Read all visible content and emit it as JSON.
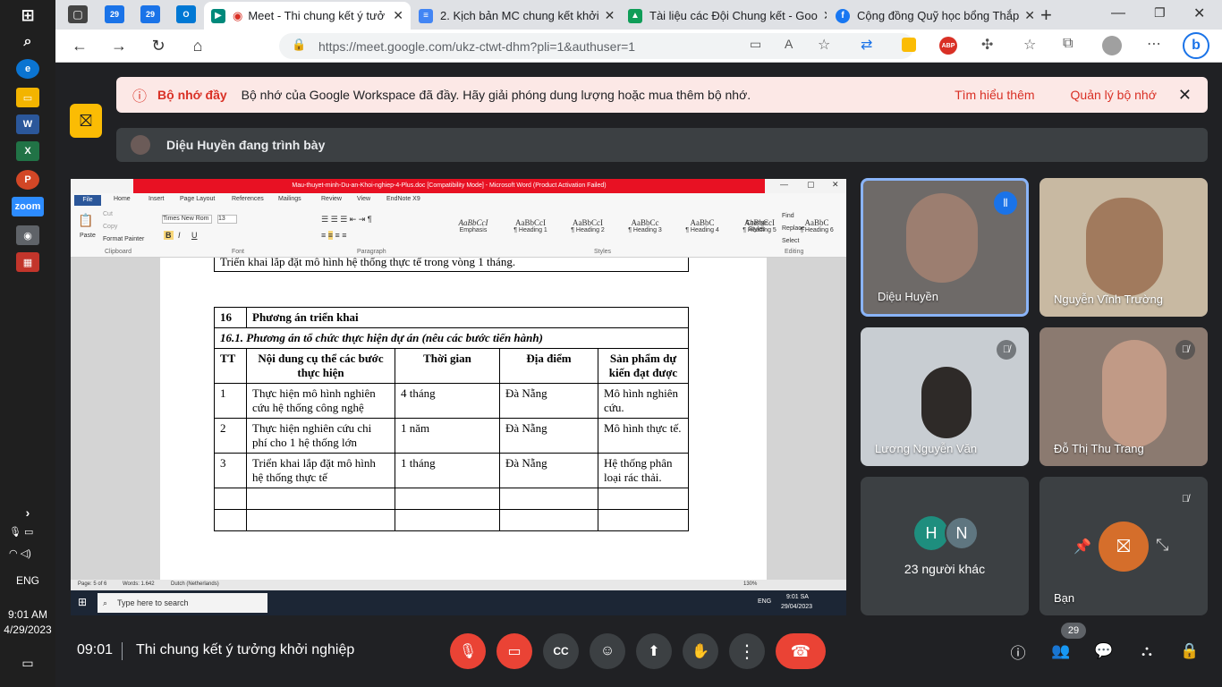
{
  "windows_taskbar": {
    "language": "ENG",
    "time": "9:01 AM",
    "date": "4/29/2023"
  },
  "browser": {
    "tabs": [
      {
        "label": "Meet - Thi chung kết ý tưở",
        "active": true
      },
      {
        "label": "2. Kịch bản MC chung kết khởi"
      },
      {
        "label": "Tài liệu các Đội Chung kết - Goo"
      },
      {
        "label": "Cộng đồng Quỹ học bổng Thắp"
      }
    ],
    "mini_tabs": [
      "29",
      "29"
    ],
    "url": "https://meet.google.com/ukz-ctwt-dhm?pli=1&authuser=1"
  },
  "banner": {
    "title": "Bộ nhớ đầy",
    "message": "Bộ nhớ của Google Workspace đã đầy. Hãy giải phóng dung lượng hoặc mua thêm bộ nhớ.",
    "learn_more": "Tìm hiểu thêm",
    "manage": "Quản lý bộ nhớ"
  },
  "presenting": {
    "label": "Diệu Huyền đang trình bày"
  },
  "word": {
    "title": "Mau-thuyet-minh-Du-an-Khoi-nghiep-4-Plus.doc [Compatibility Mode] - Microsoft Word (Product Activation Failed)",
    "menu": [
      "File",
      "Home",
      "Insert",
      "Page Layout",
      "References",
      "Mailings",
      "Review",
      "View",
      "EndNote X9"
    ],
    "font_name": "Times New Rom",
    "font_size": "13",
    "clipboard": {
      "paste": "Paste",
      "cut": "Cut",
      "copy": "Copy",
      "format_painter": "Format Painter",
      "group": "Clipboard"
    },
    "group_labels": {
      "font": "Font",
      "paragraph": "Paragraph",
      "styles": "Styles",
      "editing": "Editing"
    },
    "styles": [
      {
        "sample": "AaBbCcI",
        "name": "Emphasis"
      },
      {
        "sample": "AaBbCcI",
        "name": "¶ Heading 1"
      },
      {
        "sample": "AaBbCcI",
        "name": "¶ Heading 2"
      },
      {
        "sample": "AaBbCc",
        "name": "¶ Heading 3"
      },
      {
        "sample": "AaBbC",
        "name": "¶ Heading 4"
      },
      {
        "sample": "AaBbCcI",
        "name": "¶ Heading 5"
      },
      {
        "sample": "AaBbC",
        "name": "¶ Heading 6"
      }
    ],
    "change_styles": "Change Styles",
    "editing": [
      "Find",
      "Replace",
      "Select"
    ],
    "top_line": "Triển khai lắp đặt mô hình hệ thống thực tế trong vòng 1 tháng.",
    "section_number": "16",
    "section_title": "Phương án triển khai",
    "subsection": "16.1. Phương án tổ chức thực hiện dự án (nêu các bước tiến hành)",
    "table_headers": [
      "TT",
      "Nội dung cụ thể các bước thực hiện",
      "Thời gian",
      "Địa điểm",
      "Sản phẩm dự kiến đạt được"
    ],
    "table_rows": [
      [
        "1",
        "Thực hiện mô hình nghiên cứu hệ thống công nghệ",
        "4 tháng",
        "Đà Nẵng",
        "Mô hình nghiên cứu."
      ],
      [
        "2",
        "Thực hiện nghiên cứu chi phí cho 1 hệ thống lớn",
        "1 năm",
        "Đà Nẵng",
        "Mô hình thực tế."
      ],
      [
        "3",
        "Triển khai lắp đặt mô hình hệ thống thực tế",
        "1 tháng",
        "Đà Nẵng",
        "Hệ thống phân loại rác thải."
      ]
    ],
    "status": {
      "page": "Page: 5 of 6",
      "words": "Words: 1.642",
      "lang": "Dutch (Netherlands)",
      "zoom": "130%"
    },
    "inner_taskbar": {
      "search": "Type here to search",
      "lang": "ENG",
      "time": "9:01 SA",
      "date": "29/04/2023"
    }
  },
  "participants": [
    {
      "name": "Diệu Huyền",
      "speaking": true
    },
    {
      "name": "Nguyễn Vĩnh Trường"
    },
    {
      "name": "Lương Nguyễn Văn",
      "muted": true
    },
    {
      "name": "Đỗ Thị Thu Trang",
      "muted": true
    }
  ],
  "others": {
    "avatars": [
      "H",
      "N"
    ],
    "label": "23 người khác"
  },
  "self": {
    "name": "Bạn"
  },
  "bottom": {
    "time": "09:01",
    "meeting_title": "Thi chung kết ý tưởng khởi nghiệp",
    "people_count": "29"
  },
  "colors": {
    "meet_bg": "#202124",
    "danger": "#ea4335",
    "banner_bg": "#fce8e6",
    "speaking": "#8ab4f8"
  }
}
